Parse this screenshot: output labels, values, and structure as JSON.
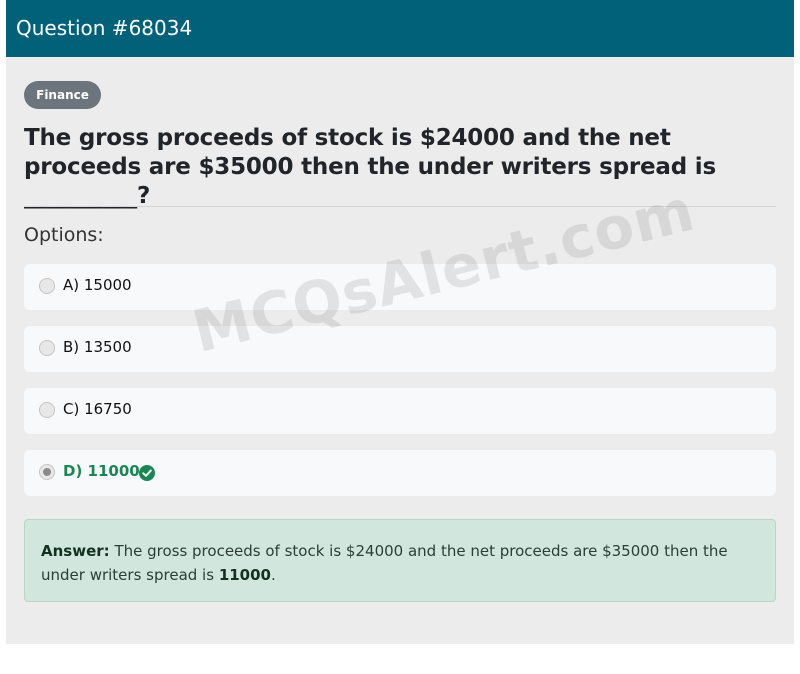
{
  "header": {
    "title": "Question #68034"
  },
  "category": "Finance",
  "question": "The gross proceeds of stock is $24000 and the net proceeds are $35000 then the under writers spread is __________?",
  "options_label": "Options:",
  "options": [
    {
      "label": "A) 15000",
      "selected": false,
      "correct": false
    },
    {
      "label": "B) 13500",
      "selected": false,
      "correct": false
    },
    {
      "label": "C) 16750",
      "selected": false,
      "correct": false
    },
    {
      "label": "D) 11000",
      "selected": true,
      "correct": true
    }
  ],
  "answer": {
    "prefix": "Answer:",
    "text": "The gross proceeds of stock is $24000 and the net proceeds are $35000 then the under writers spread is",
    "value": "11000",
    "suffix": "."
  },
  "watermark": "MCQsAlert.com",
  "colors": {
    "header": "#006179",
    "correct": "#198754",
    "answer_bg": "#d1e7dd"
  },
  "icons": {
    "correct_option": "check-circle-icon"
  }
}
